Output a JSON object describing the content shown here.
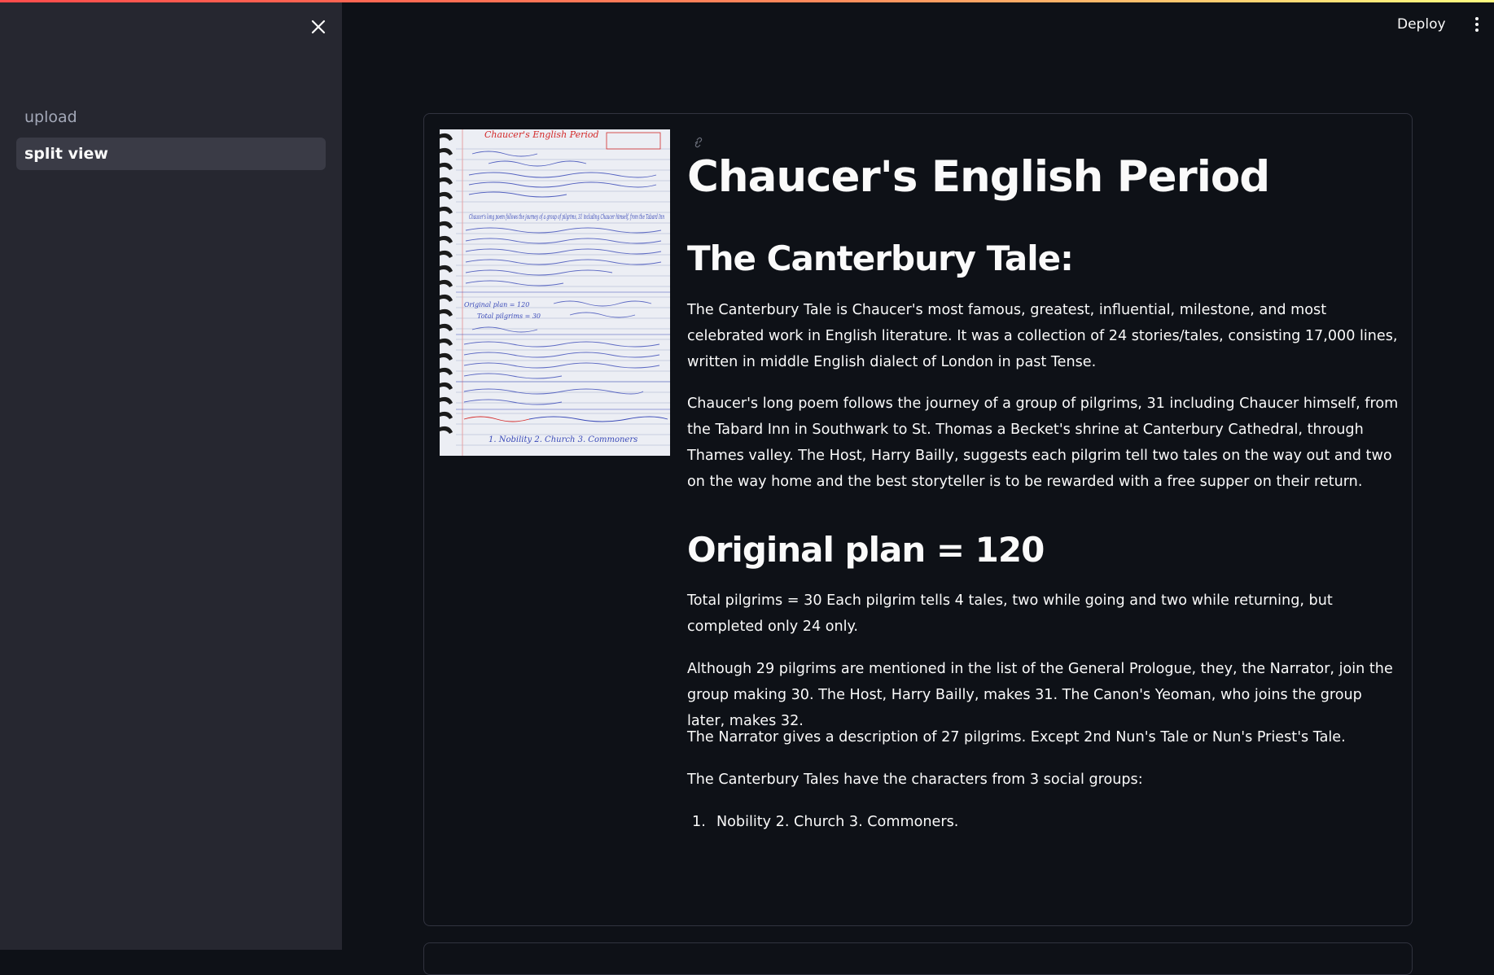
{
  "sidebar": {
    "items": [
      {
        "label": "upload"
      },
      {
        "label": "split view"
      }
    ]
  },
  "header": {
    "deploy_label": "Deploy"
  },
  "document_image": {
    "title": "Chaucer's English Period",
    "notes": [
      "Chaucer's long poem follows the journey of a group of pilgrims, 31 including Chaucer himself, from the Tabard Inn",
      "Original plan = 120",
      "Total pilgrims = 30",
      "1. Nobility 2. Church 3. Commoners"
    ]
  },
  "main": {
    "title": "Chaucer's English Period",
    "subtitle": "The Canterbury Tale:",
    "paragraphs": [
      "The Canterbury Tale is Chaucer's most famous, greatest, influential, milestone, and most celebrated work in English literature. It was a collection of 24 stories/tales, consisting 17,000 lines, written in middle English dialect of London in past Tense.",
      "Chaucer's long poem follows the journey of a group of pilgrims, 31 including Chaucer himself, from the Tabard Inn in Southwark to St. Thomas a Becket's shrine at Canterbury Cathedral, through Thames valley. The Host, Harry Bailly, suggests each pilgrim tell two tales on the way out and two on the way home and the best storyteller is to be rewarded with a free supper on their return."
    ],
    "plan_heading": "Original plan = 120",
    "plan_paragraphs": [
      "Total pilgrims = 30 Each pilgrim tells 4 tales, two while going and two while returning, but completed only 24 only.",
      "Although 29 pilgrims are mentioned in the list of the General Prologue, they, the Narrator, join the group making 30. The Host, Harry Bailly, makes 31. The Canon's Yeoman, who joins the group later, makes 32.",
      "The Narrator gives a description of 27 pilgrims. Except 2nd Nun's Tale or Nun's Priest's Tale.",
      "The Canterbury Tales have the characters from 3 social groups:"
    ],
    "list": [
      {
        "num": "1.",
        "text": "Nobility 2. Church 3. Commoners."
      }
    ]
  },
  "colors": {
    "background": "#0e1117",
    "sidebar": "#262730",
    "accent": "#ff4b4b"
  }
}
